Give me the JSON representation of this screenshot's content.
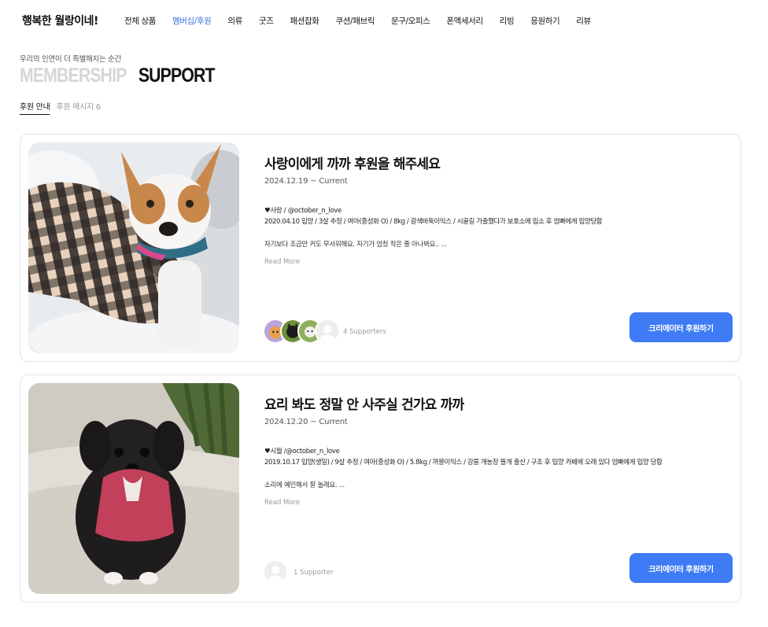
{
  "header": {
    "logo": "행복한 월랑이네!",
    "nav": [
      "전체 상품",
      "멤버십/후원",
      "의류",
      "굿즈",
      "패션잡화",
      "쿠션/패브릭",
      "문구/오피스",
      "폰액세서리",
      "리빙",
      "응원하기",
      "리뷰"
    ],
    "active_index": 1,
    "accent_color": "#3b6fe0"
  },
  "hero": {
    "eyebrow": "우리의 인연이 더 특별해지는 순간",
    "title_muted": "MEMBERSHIP",
    "title_main": "SUPPORT"
  },
  "subtabs": [
    {
      "label": "후원 안내",
      "active": true
    },
    {
      "label": "후원 메시지 6",
      "active": false
    }
  ],
  "cards": [
    {
      "title": "사랑이에게 까까 후원을 해주세요",
      "date": "2024.12.19 ~ Current",
      "handle": "♥사랑 / @october_n_love",
      "info": "2020.04.10 입양 / 3살 추정 / 여아(중성화 O) / 8kg / 갈색바둑이믹스 / 시골길 가출했다가 보호소에 입소 후 엄빠에게 입양당함",
      "desc": "자기보다 조금만 커도 무서워해요. 자기가 엄청 작은 줄 아나봐요.. ...",
      "more": "Read More",
      "supporters": "4 Supporters",
      "cta": "크리에이터 후원하기",
      "photo_icon": "dog-in-plaid-coat-photo"
    },
    {
      "title": "요리 봐도 정말 안 사주실 건가요 까까",
      "date": "2024.12.20 ~ Current",
      "handle": "♥시월 /@october_n_love",
      "info": "2019.10.17 입양(생일) / 9살 추정 / 여아(중성화 O) / 5.8kg / 까뭉이믹스 / 강릉 개농장 뜰개 출신 / 구조 후 입양 카페에 오래 있다 엄빠에게 입양 당함",
      "desc": "소리에 예민해서 잘 놀래요. ...",
      "more": "Read More",
      "supporters": "1 Supporter",
      "cta": "크리에이터 후원하기",
      "photo_icon": "black-dog-in-red-vest-photo"
    }
  ],
  "cta_color": "#3f7bf5"
}
